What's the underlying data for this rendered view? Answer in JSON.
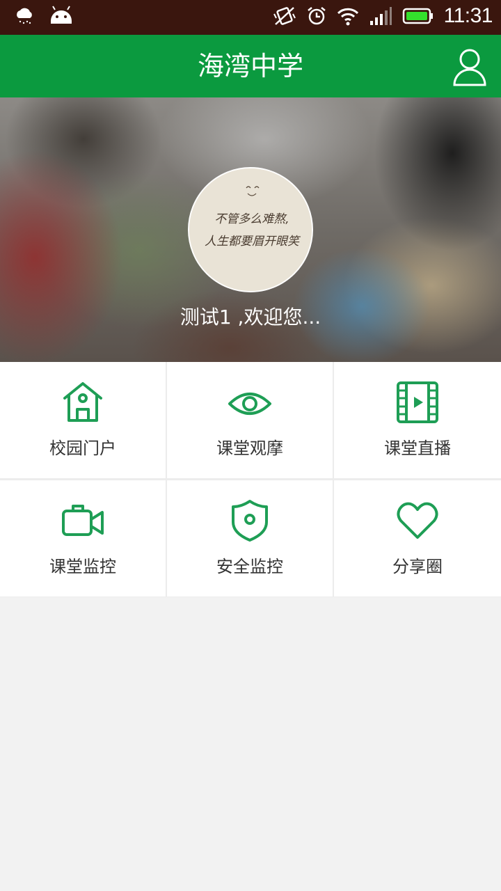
{
  "status_bar": {
    "time": "11:31",
    "icons": [
      "weather-rain-icon",
      "android-icon",
      "vibrate-off-icon",
      "alarm-icon",
      "wifi-icon",
      "signal-icon",
      "battery-icon"
    ]
  },
  "header": {
    "title": "海湾中学",
    "profile_icon": "user-icon"
  },
  "banner": {
    "welcome_text": "测试1 ,欢迎您...",
    "avatar_text_line1": "不管多么难熬,",
    "avatar_text_line2": "人生都要眉开眼笑"
  },
  "menu": {
    "items": [
      {
        "label": "校园门户",
        "icon": "house-icon"
      },
      {
        "label": "课堂观摩",
        "icon": "eye-icon"
      },
      {
        "label": "课堂直播",
        "icon": "film-play-icon"
      },
      {
        "label": "课堂监控",
        "icon": "video-camera-icon"
      },
      {
        "label": "安全监控",
        "icon": "shield-icon"
      },
      {
        "label": "分享圈",
        "icon": "heart-icon"
      }
    ]
  },
  "colors": {
    "primary_green": "#0b9a3f",
    "icon_green": "#1e9e55",
    "status_bar_bg": "#3a160e",
    "page_bg": "#f2f2f2"
  }
}
